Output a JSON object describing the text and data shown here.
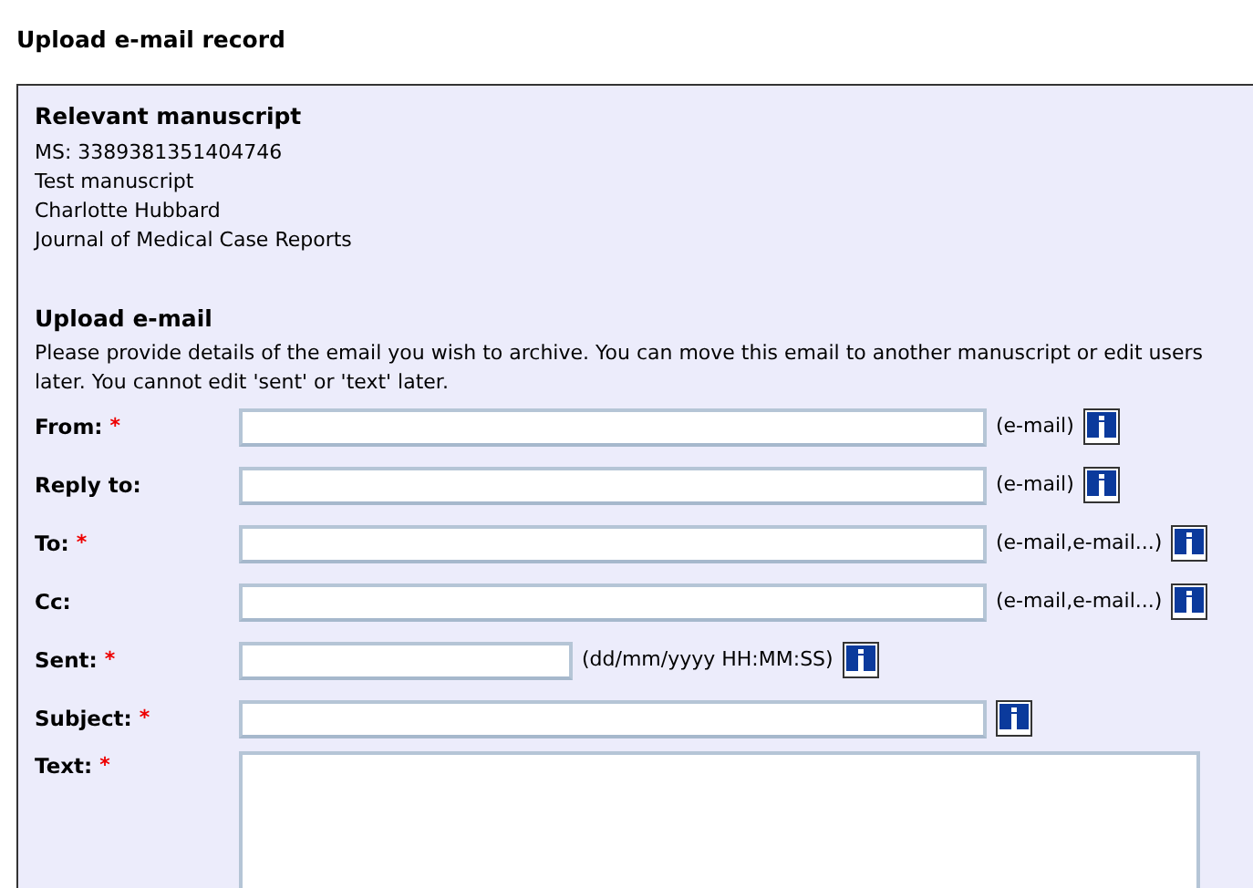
{
  "page_title": "Upload e-mail record",
  "manuscript": {
    "heading": "Relevant manuscript",
    "lines": [
      "MS: 3389381351404746",
      "Test manuscript",
      "Charlotte Hubbard",
      "Journal of Medical Case Reports"
    ]
  },
  "upload": {
    "heading": "Upload e-mail",
    "description": "Please provide details of the email you wish to archive. You can move this email to another manuscript or edit users later. You cannot edit 'sent' or 'text' later.",
    "fields": [
      {
        "label": "From:",
        "required_mark": "*",
        "kind": "input",
        "hint": "(e-mail)",
        "info": true
      },
      {
        "label": "Reply to:",
        "kind": "input",
        "hint": "(e-mail)",
        "info": true
      },
      {
        "label": "To:",
        "required_mark": "*",
        "kind": "input",
        "hint": "(e-mail,e-mail...)",
        "info": true
      },
      {
        "label": "Cc:",
        "kind": "input",
        "hint": "(e-mail,e-mail...)",
        "info": true
      },
      {
        "label": "Sent:",
        "required_mark": "*",
        "kind": "short",
        "hint": "(dd/mm/yyyy HH:MM:SS)",
        "info": true
      },
      {
        "label": "Subject:",
        "required_mark": "*",
        "kind": "input",
        "info": true
      },
      {
        "label": "Text:",
        "required_mark": "*",
        "kind": "textarea"
      }
    ]
  }
}
